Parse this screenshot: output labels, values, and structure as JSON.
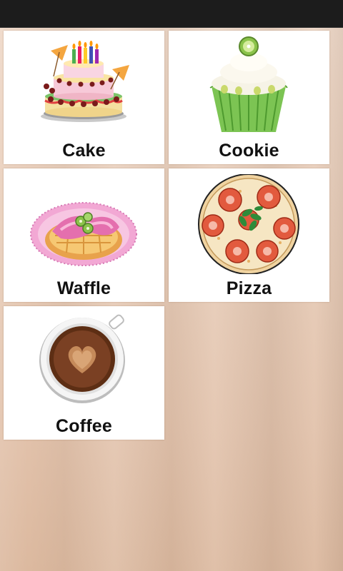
{
  "menu": {
    "items": [
      {
        "label": "Cake",
        "icon": "cake-icon"
      },
      {
        "label": "Cookie",
        "icon": "cupcake-icon"
      },
      {
        "label": "Waffle",
        "icon": "waffle-icon"
      },
      {
        "label": "Pizza",
        "icon": "pizza-icon"
      },
      {
        "label": "Coffee",
        "icon": "coffee-cup-icon"
      }
    ]
  },
  "colors": {
    "tile_background": "#ffffff",
    "status_bar": "#1c1c1c",
    "wallpaper": "#e8cdb9"
  }
}
